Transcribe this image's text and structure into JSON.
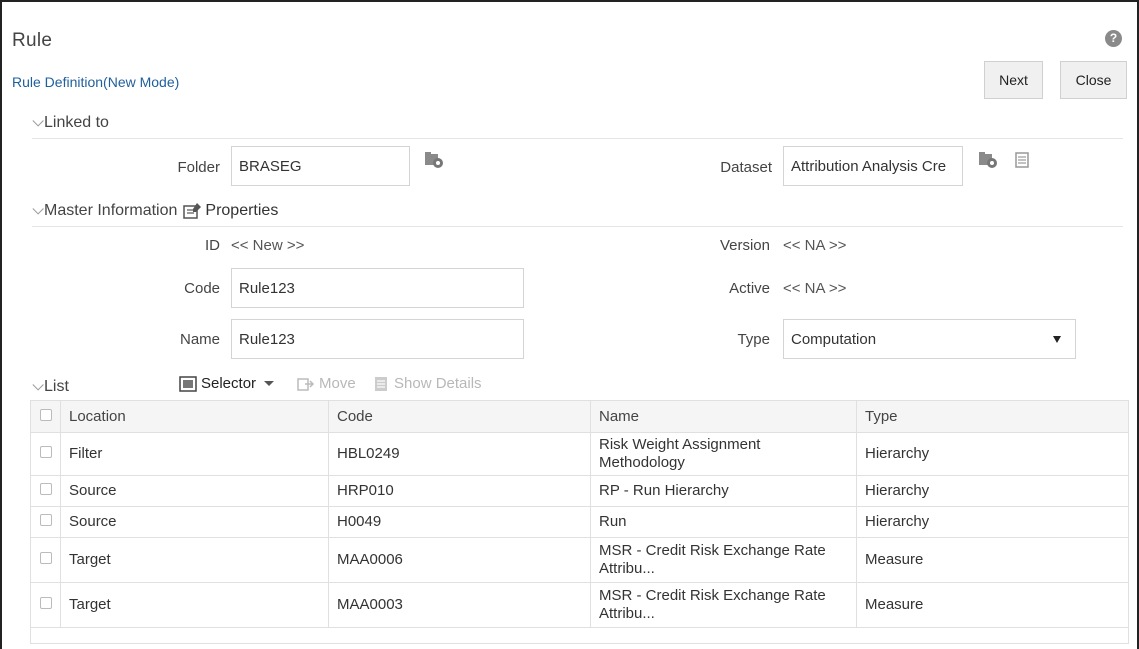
{
  "window": {
    "title": "Rule",
    "subtitle": "Rule Definition(New Mode)"
  },
  "toolbar": {
    "next_label": "Next",
    "close_label": "Close"
  },
  "linked": {
    "section_label": "Linked to",
    "folder_label": "Folder",
    "folder_value": "BRASEG",
    "dataset_label": "Dataset",
    "dataset_value": "Attribution Analysis Cre"
  },
  "master": {
    "section_label": "Master Information",
    "properties_label": "Properties",
    "id_label": "ID",
    "id_value": "<< New >>",
    "version_label": "Version",
    "version_value": "<< NA >>",
    "code_label": "Code",
    "code_value": "Rule123",
    "active_label": "Active",
    "active_value": "<< NA >>",
    "name_label": "Name",
    "name_value": "Rule123",
    "type_label": "Type",
    "type_value": "Computation"
  },
  "list": {
    "section_label": "List",
    "selector_label": "Selector",
    "move_label": "Move",
    "show_details_label": "Show Details",
    "columns": [
      "Location",
      "Code",
      "Name",
      "Type"
    ],
    "rows": [
      {
        "location": "Filter",
        "code": "HBL0249",
        "name": "Risk Weight Assignment Methodology",
        "type": "Hierarchy"
      },
      {
        "location": "Source",
        "code": "HRP010",
        "name": "RP - Run Hierarchy",
        "type": "Hierarchy"
      },
      {
        "location": "Source",
        "code": "H0049",
        "name": "Run",
        "type": "Hierarchy"
      },
      {
        "location": "Target",
        "code": "MAA0006",
        "name": "MSR - Credit Risk Exchange Rate Attribu...",
        "type": "Measure"
      },
      {
        "location": "Target",
        "code": "MAA0003",
        "name": "MSR - Credit Risk Exchange Rate Attribu...",
        "type": "Measure"
      }
    ]
  },
  "icons": [
    "help-icon",
    "folder-settings-icon",
    "dataset-settings-icon",
    "dataset-details-icon",
    "properties-icon",
    "selector-icon",
    "move-icon",
    "show-details-icon",
    "chevron-down-icon"
  ],
  "colors": {
    "link": "#1f5f9c",
    "button_bg": "#f0f0f0",
    "header_bg": "#f5f5f5"
  }
}
